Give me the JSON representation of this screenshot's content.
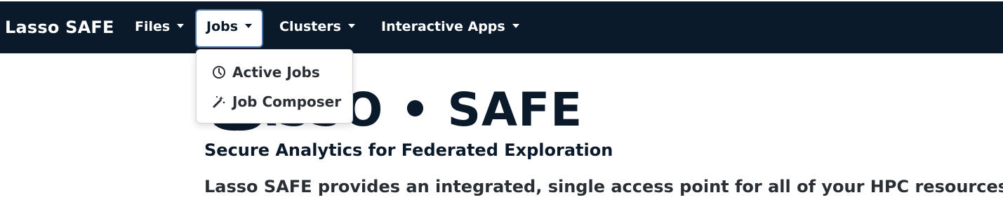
{
  "navbar": {
    "brand": "Lasso SAFE",
    "items": [
      {
        "label": "Files"
      },
      {
        "label": "Jobs"
      },
      {
        "label": "Clusters"
      },
      {
        "label": "Interactive Apps"
      }
    ]
  },
  "jobs_menu": {
    "items": [
      {
        "label": "Active Jobs",
        "icon": "clock-icon"
      },
      {
        "label": "Job Composer",
        "icon": "magic-wand-icon"
      }
    ]
  },
  "hero": {
    "title": "LASSO • SAFE",
    "subtitle": "Secure Analytics for Federated Exploration",
    "description": "Lasso SAFE provides an integrated, single access point for all of your HPC resources."
  },
  "colors": {
    "navbar_bg": "#0b1a2b",
    "text_dark": "#0b1a2b",
    "active_border": "#4a76a8"
  }
}
